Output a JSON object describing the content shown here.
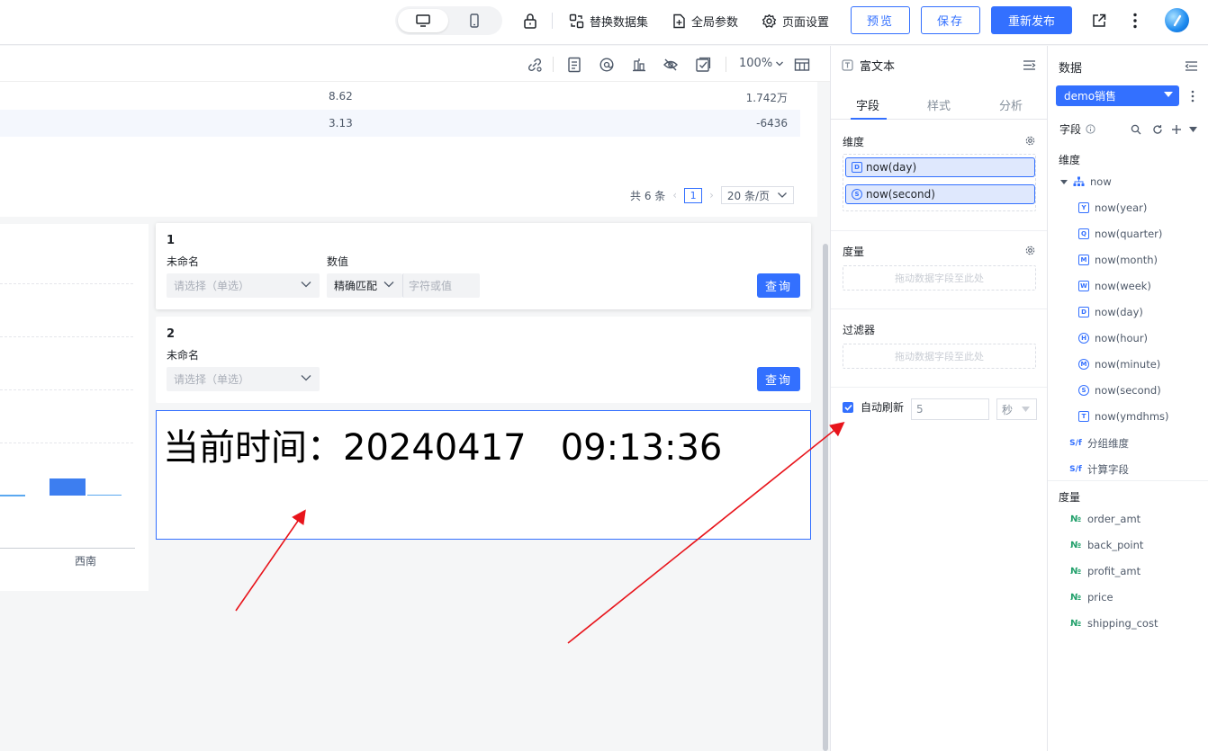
{
  "header": {
    "lock_label": "",
    "replace_dataset": "替换数据集",
    "global_params": "全局参数",
    "page_settings": "页面设置",
    "preview": "预览",
    "save": "保存",
    "republish": "重新发布"
  },
  "canvas_toolbar": {
    "zoom": "100%"
  },
  "table": {
    "rows": [
      {
        "c1": "8.62",
        "c2": "1.742万"
      },
      {
        "c1": "3.13",
        "c2": "-6436"
      }
    ],
    "pager": {
      "total": "共 6 条",
      "current_page": "1",
      "page_size": "20 条/页"
    }
  },
  "chart": {
    "x_label": "西南"
  },
  "query_cards": [
    {
      "title": "1",
      "label1": "未命名",
      "label2": "数值",
      "select_placeholder": "请选择（单选）",
      "match_mode": "精确匹配",
      "value_placeholder": "字符或值",
      "button": "查询"
    },
    {
      "title": "2",
      "label1": "未命名",
      "select_placeholder": "请选择（单选）",
      "button": "查询"
    }
  ],
  "rich_text": {
    "content": "当前时间：20240417   09:13:36"
  },
  "config_panel": {
    "title": "富文本",
    "tabs": [
      "字段",
      "样式",
      "分析"
    ],
    "dimension_title": "维度",
    "dimension_pills": [
      "now(day)",
      "now(second)"
    ],
    "measure_title": "度量",
    "measure_drop": "拖动数据字段至此处",
    "filter_title": "过滤器",
    "filter_drop": "拖动数据字段至此处",
    "auto_refresh_label": "自动刷新",
    "auto_refresh_value": "5",
    "auto_refresh_unit": "秒"
  },
  "data_panel": {
    "title": "数据",
    "dataset": "demo销售",
    "fields_label": "字段",
    "dimension_title": "维度",
    "dimension_root": "now",
    "dimension_fields": [
      "now(year)",
      "now(quarter)",
      "now(month)",
      "now(week)",
      "now(day)",
      "now(hour)",
      "now(minute)",
      "now(second)",
      "now(ymdhms)"
    ],
    "group_dimension": "分组维度",
    "calc_field": "计算字段",
    "measure_title": "度量",
    "measure_fields": [
      "order_amt",
      "back_point",
      "profit_amt",
      "price",
      "shipping_cost"
    ]
  },
  "colors": {
    "primary": "#3370ff",
    "annotation_arrow": "#e8141b"
  }
}
